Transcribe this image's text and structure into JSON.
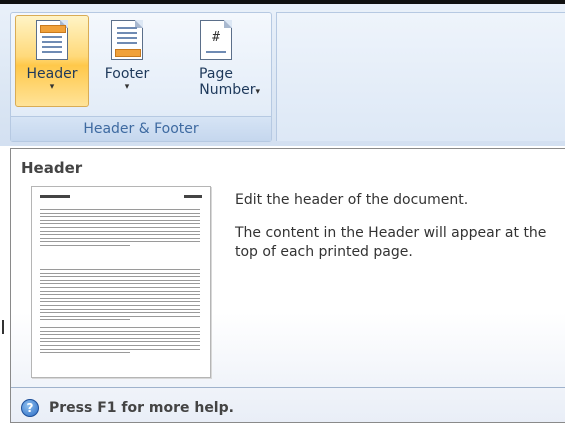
{
  "ribbon": {
    "group_label": "Header & Footer",
    "buttons": [
      {
        "id": "header",
        "line1": "Header",
        "line2": "",
        "has_arrow": true,
        "icon": "header-page-icon",
        "active": true
      },
      {
        "id": "footer",
        "line1": "Footer",
        "line2": "",
        "has_arrow": true,
        "icon": "footer-page-icon",
        "active": false
      },
      {
        "id": "page-number",
        "line1": "Page",
        "line2": "Number",
        "has_arrow": true,
        "icon": "page-number-icon",
        "icon_text": "#",
        "active": false
      }
    ],
    "arrow_glyph": "▾"
  },
  "tooltip": {
    "title": "Header",
    "description": "Edit the header of the document.",
    "detail": "The content in the Header will appear at the top of each printed page.",
    "help_text": "Press F1 for more help.",
    "help_icon": "help-icon",
    "help_icon_glyph": "?"
  },
  "colors": {
    "active_button": "#ffc84a",
    "group_label": "#3e6aa1",
    "header_band": "#f0a13a"
  }
}
